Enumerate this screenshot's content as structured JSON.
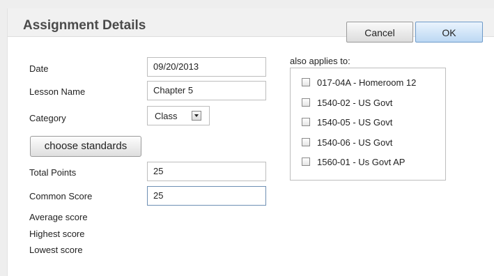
{
  "dialog": {
    "title": "Assignment Details",
    "cancel_label": "Cancel",
    "ok_label": "OK"
  },
  "form": {
    "date_label": "Date",
    "date_value": "09/20/2013",
    "lesson_label": "Lesson Name",
    "lesson_value": "Chapter 5",
    "category_label": "Category",
    "category_value": "Class",
    "choose_standards_label": "choose standards",
    "total_points_label": "Total Points",
    "total_points_value": "25",
    "common_score_label": "Common Score",
    "common_score_value": "25",
    "average_label": "Average score",
    "highest_label": "Highest score",
    "lowest_label": "Lowest score"
  },
  "applies": {
    "label": "also applies to:",
    "items": [
      {
        "label": "017-04A - Homeroom 12",
        "checked": false
      },
      {
        "label": "1540-02 - US Govt",
        "checked": false
      },
      {
        "label": "1540-05 - US Govt",
        "checked": false
      },
      {
        "label": "1540-06 - US Govt",
        "checked": false
      },
      {
        "label": "1560-01 - Us Govt AP",
        "checked": false
      }
    ]
  }
}
